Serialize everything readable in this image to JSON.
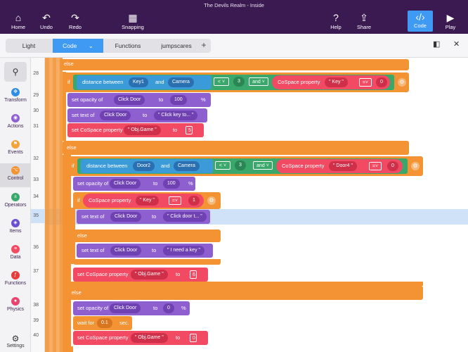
{
  "title": "The Devils Realm - Inside",
  "toolbar": {
    "home": "Home",
    "undo": "Undo",
    "redo": "Redo",
    "snapping": "Snapping",
    "help": "Help",
    "share": "Share",
    "code": "Code",
    "play": "Play"
  },
  "tabs": {
    "light": "Light",
    "code": "Code",
    "functions": "Functions",
    "jumpscares": "jumpscares",
    "add": "+"
  },
  "sidebar": {
    "transform": "Transform",
    "actions": "Actions",
    "events": "Events",
    "control": "Control",
    "operators": "Operators",
    "items": "Items",
    "data": "Data",
    "functions": "Functions",
    "physics": "Physics",
    "settings": "Settings"
  },
  "lines": [
    "28",
    "29",
    "30",
    "31",
    "32",
    "33",
    "34",
    "35",
    "36",
    "37",
    "38",
    "39",
    "40"
  ],
  "kw": {
    "else": "else",
    "if": "if",
    "and": "and",
    "to": "to",
    "pct": "%",
    "sec": "sec.",
    "caret": "˅"
  },
  "blocks": {
    "dist_between": "distance between",
    "key1": "Key1",
    "camera": "Camera",
    "lt": "<",
    "three": "3",
    "cospace_prop": "CoSpace property",
    "key_str": "\" Key \"",
    "eq": "=",
    "zero": "0",
    "set_opacity_of": "set opacity of",
    "click_door": "Click Door",
    "hundred": "100",
    "set_text_of": "set text of",
    "txt_key_to": "\" Click key to... \"",
    "set_cospace_prop": "set CoSpace property",
    "obj_game": "\" Obj.Game \"",
    "five": "5",
    "door2": "Door2",
    "door4_str": "\" Door4 \"",
    "one": "1",
    "txt_door": "\" Click door t... \"",
    "txt_need_key": "\" I need a key \"",
    "six": "6",
    "wait_for": "wait for",
    "zero_one": "0.1"
  },
  "colors": {
    "topbar": "#3b1a52",
    "accent": "#3f9af3",
    "control": "#f39334",
    "looks": "#8e5fcf",
    "data": "#f24a63",
    "sensing": "#3b9bd9",
    "operator": "#3aa86a"
  }
}
